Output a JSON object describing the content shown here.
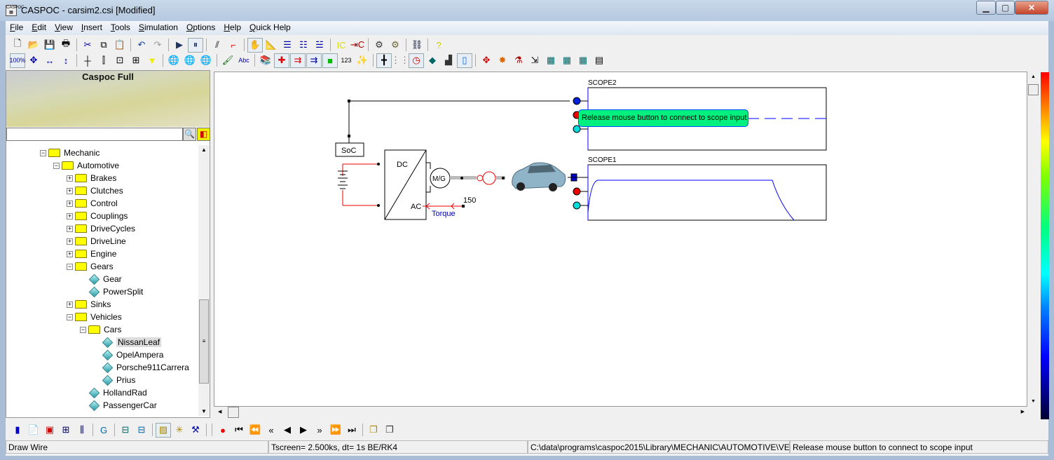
{
  "window": {
    "title": "CASPOC - carsim2.csi [Modified]",
    "minimize": "▁",
    "maximize": "▢",
    "close": "✕"
  },
  "menu": [
    {
      "key": "F",
      "rest": "ile"
    },
    {
      "key": "E",
      "rest": "dit"
    },
    {
      "key": "V",
      "rest": "iew"
    },
    {
      "key": "I",
      "rest": "nsert"
    },
    {
      "key": "T",
      "rest": "ools"
    },
    {
      "key": "S",
      "rest": "imulation"
    },
    {
      "key": "O",
      "rest": "ptions"
    },
    {
      "key": "H",
      "rest": "elp"
    },
    {
      "key": "Q",
      "rest": "uick Help"
    }
  ],
  "toolbar1": [
    {
      "icon": "new-file-icon",
      "g": "🗋",
      "c": "#000"
    },
    {
      "icon": "open-folder-icon",
      "g": "📂",
      "c": "#b80"
    },
    {
      "icon": "save-icon",
      "g": "💾",
      "c": "#000"
    },
    {
      "icon": "print-icon",
      "g": "🖶",
      "c": "#000"
    },
    "sep",
    {
      "icon": "cut-icon",
      "g": "✂",
      "c": "#00a"
    },
    {
      "icon": "copy-icon",
      "g": "⧉",
      "c": "#000"
    },
    {
      "icon": "paste-icon",
      "g": "📋",
      "c": "#000"
    },
    "sep",
    {
      "icon": "undo-icon",
      "g": "↶",
      "c": "#14a"
    },
    {
      "icon": "redo-icon",
      "g": "↷",
      "c": "#999"
    },
    "sep",
    {
      "icon": "run-icon",
      "g": "▶",
      "c": "#236"
    },
    {
      "icon": "pause-icon",
      "g": "⏸",
      "c": "#236",
      "pressed": true
    },
    "sep",
    {
      "icon": "wire-icon",
      "g": "⫽",
      "c": "#000"
    },
    {
      "icon": "wire-color-icon",
      "g": "⌐",
      "c": "#d00"
    },
    "sep",
    {
      "icon": "hand-icon",
      "g": "✋",
      "c": "#000",
      "pressed": true
    },
    {
      "icon": "measure-icon",
      "g": "📐",
      "c": "#00a"
    },
    {
      "icon": "list-icon",
      "g": "☰",
      "c": "#00a"
    },
    {
      "icon": "list-indent-icon",
      "g": "☷",
      "c": "#00a"
    },
    {
      "icon": "list-check-icon",
      "g": "☱",
      "c": "#00a"
    },
    "sep",
    {
      "icon": "ic-in-icon",
      "g": "IC",
      "c": "#dd0"
    },
    {
      "icon": "ic-out-icon",
      "g": "⇥C",
      "c": "#a00"
    },
    "sep",
    {
      "icon": "component-icon",
      "g": "⚙",
      "c": "#333"
    },
    {
      "icon": "component-new-icon",
      "g": "⚙",
      "c": "#663"
    },
    "sep",
    {
      "icon": "network-icon",
      "g": "⛓",
      "c": "#013"
    },
    "sep",
    {
      "icon": "help-icon",
      "g": "?",
      "c": "#cc0"
    }
  ],
  "toolbar2": [
    {
      "icon": "zoom-100-icon",
      "g": "100%",
      "c": "#00a",
      "pressed": true
    },
    {
      "icon": "zoom-fit-icon",
      "g": "✥",
      "c": "#00a"
    },
    {
      "icon": "zoom-width-icon",
      "g": "↔",
      "c": "#00a"
    },
    {
      "icon": "zoom-height-icon",
      "g": "↕",
      "c": "#00a"
    },
    "sep",
    {
      "icon": "ground-icon",
      "g": "┼",
      "c": "#000"
    },
    {
      "icon": "resistor-icon",
      "g": "⫿",
      "c": "#000"
    },
    {
      "icon": "switch-icon",
      "g": "⊡",
      "c": "#000"
    },
    {
      "icon": "block-icon",
      "g": "⊞",
      "c": "#000"
    },
    {
      "icon": "probe-icon",
      "g": "▼",
      "c": "#ee0"
    },
    "sep",
    {
      "icon": "globe-icon",
      "g": "🌐",
      "c": "#063"
    },
    {
      "icon": "globe-folder-icon",
      "g": "🌐",
      "c": "#a80"
    },
    {
      "icon": "globe-link-icon",
      "g": "🌐",
      "c": "#066"
    },
    "sep",
    {
      "icon": "brush-icon",
      "g": "🖌",
      "c": "#060"
    },
    {
      "icon": "text-icon",
      "g": "Abc",
      "c": "#00a"
    },
    "sep",
    {
      "icon": "library-icon",
      "g": "📚",
      "c": "#06a"
    },
    {
      "icon": "node-icon",
      "g": "✚",
      "c": "#d00",
      "pressed": true
    },
    {
      "icon": "arrow-red-icon",
      "g": "⇉",
      "c": "#d00",
      "pressed": true
    },
    {
      "icon": "arrow-signal-icon",
      "g": "⇉",
      "c": "#00a",
      "pressed": true
    },
    {
      "icon": "block-green-icon",
      "g": "■",
      "c": "#0b0",
      "pressed": true
    },
    {
      "icon": "number-icon",
      "g": "123",
      "c": "#000"
    },
    {
      "icon": "magic-icon",
      "g": "✨",
      "c": "#000"
    },
    "sep",
    {
      "icon": "crosshair-icon",
      "g": "╋",
      "c": "#000",
      "pressed": true
    },
    {
      "icon": "grid-icon",
      "g": "⋮⋮",
      "c": "#777"
    },
    {
      "icon": "clock-icon",
      "g": "◷",
      "c": "#c00",
      "pressed": true
    },
    {
      "icon": "paint-icon",
      "g": "◆",
      "c": "#066"
    },
    {
      "icon": "bars-icon",
      "g": "▟",
      "c": "#333"
    },
    {
      "icon": "level-icon",
      "g": "▯",
      "c": "#06c",
      "pressed": true
    },
    "sep",
    {
      "icon": "move-icon",
      "g": "✥",
      "c": "#c00"
    },
    {
      "icon": "star-icon",
      "g": "✸",
      "c": "#d60"
    },
    {
      "icon": "flask-icon",
      "g": "⚗",
      "c": "#a00"
    },
    {
      "icon": "export-icon",
      "g": "⇲",
      "c": "#000"
    },
    {
      "icon": "chip-icon",
      "g": "▦",
      "c": "#066"
    },
    {
      "icon": "chip2-icon",
      "g": "▦",
      "c": "#066"
    },
    {
      "icon": "chip3-icon",
      "g": "▦",
      "c": "#066"
    },
    {
      "icon": "table-icon",
      "g": "▤",
      "c": "#000"
    }
  ],
  "library": {
    "banner_title": "Caspoc Full",
    "search_value": "",
    "search_icon": "magnifier-icon",
    "filter_icon": "filter-icon"
  },
  "tree": [
    {
      "label": "Mechanic",
      "level": 0,
      "type": "folder",
      "state": "open"
    },
    {
      "label": "Automotive",
      "level": 1,
      "type": "folder",
      "state": "open"
    },
    {
      "label": "Brakes",
      "level": 2,
      "type": "folder",
      "state": "closed"
    },
    {
      "label": "Clutches",
      "level": 2,
      "type": "folder",
      "state": "closed"
    },
    {
      "label": "Control",
      "level": 2,
      "type": "folder",
      "state": "closed"
    },
    {
      "label": "Couplings",
      "level": 2,
      "type": "folder",
      "state": "closed"
    },
    {
      "label": "DriveCycles",
      "level": 2,
      "type": "folder",
      "state": "closed"
    },
    {
      "label": "DriveLine",
      "level": 2,
      "type": "folder",
      "state": "closed"
    },
    {
      "label": "Engine",
      "level": 2,
      "type": "folder",
      "state": "closed"
    },
    {
      "label": "Gears",
      "level": 2,
      "type": "folder",
      "state": "open"
    },
    {
      "label": "Gear",
      "level": 3,
      "type": "leaf"
    },
    {
      "label": "PowerSplit",
      "level": 3,
      "type": "leaf"
    },
    {
      "label": "Sinks",
      "level": 2,
      "type": "folder",
      "state": "closed"
    },
    {
      "label": "Vehicles",
      "level": 2,
      "type": "folder",
      "state": "open"
    },
    {
      "label": "Cars",
      "level": 3,
      "type": "folder",
      "state": "open"
    },
    {
      "label": "NissanLeaf",
      "level": 4,
      "type": "leaf",
      "selected": true
    },
    {
      "label": "OpelAmpera",
      "level": 4,
      "type": "leaf"
    },
    {
      "label": "Porsche911Carrera",
      "level": 4,
      "type": "leaf"
    },
    {
      "label": "Prius",
      "level": 4,
      "type": "leaf"
    },
    {
      "label": "HollandRad",
      "level": 3,
      "type": "leaf"
    },
    {
      "label": "PassengerCar",
      "level": 3,
      "type": "leaf"
    }
  ],
  "diagram": {
    "soc": "SoC",
    "dc": "DC",
    "ac": "AC",
    "mg": "M/G",
    "torque": "Torque",
    "torque_value": "150",
    "scope1": "SCOPE1",
    "scope2": "SCOPE2",
    "tooltip": "Release mouse button to connect to scope input",
    "trace_color": "#0000ff",
    "tooltip_color": "#00f080"
  },
  "bottom_toolbar": [
    {
      "icon": "marker-icon",
      "g": "▮",
      "c": "#00c"
    },
    {
      "icon": "document-icon",
      "g": "📄",
      "c": "#000"
    },
    {
      "icon": "counter-icon",
      "g": "▣",
      "c": "#c00"
    },
    {
      "icon": "tree-icon",
      "g": "⊞",
      "c": "#006"
    },
    {
      "icon": "chip-icon",
      "g": "⫼",
      "c": "#006"
    },
    "sep",
    {
      "icon": "refresh-icon",
      "g": "G",
      "c": "#06a"
    },
    "sep",
    {
      "icon": "layers-icon",
      "g": "⊟",
      "c": "#066"
    },
    {
      "icon": "layers2-icon",
      "g": "⊟",
      "c": "#06a"
    },
    "sep",
    {
      "icon": "picture-icon",
      "g": "▨",
      "c": "#a80",
      "pressed": true
    },
    {
      "icon": "sparkle-icon",
      "g": "✳",
      "c": "#a80"
    },
    {
      "icon": "tools-icon",
      "g": "⚒",
      "c": "#00a"
    },
    "sep",
    "sep",
    {
      "icon": "record-icon",
      "g": "●",
      "c": "#e00"
    },
    {
      "icon": "first-icon",
      "g": "⏮",
      "c": "#000"
    },
    {
      "icon": "fast-rewind-icon",
      "g": "⏪",
      "c": "#000"
    },
    {
      "icon": "rewind-icon",
      "g": "«",
      "c": "#000"
    },
    {
      "icon": "step-back-icon",
      "g": "◀",
      "c": "#000"
    },
    {
      "icon": "play-icon",
      "g": "▶",
      "c": "#000"
    },
    {
      "icon": "forward-icon",
      "g": "»",
      "c": "#000"
    },
    {
      "icon": "fast-forward-icon",
      "g": "⏩",
      "c": "#000"
    },
    {
      "icon": "last-icon",
      "g": "⏭",
      "c": "#000"
    },
    "sep",
    {
      "icon": "windows-icon",
      "g": "❐",
      "c": "#a80"
    },
    {
      "icon": "windows2-icon",
      "g": "❐",
      "c": "#333"
    }
  ],
  "status": {
    "mode": "Draw Wire",
    "time": "Tscreen= 2.500ks, dt= 1s BE/RK4",
    "path": "C:\\data\\programs\\caspoc2015\\Library\\MECHANIC\\AUTOMOTIVE\\VE",
    "message": "Release mouse button to connect to scope input"
  }
}
